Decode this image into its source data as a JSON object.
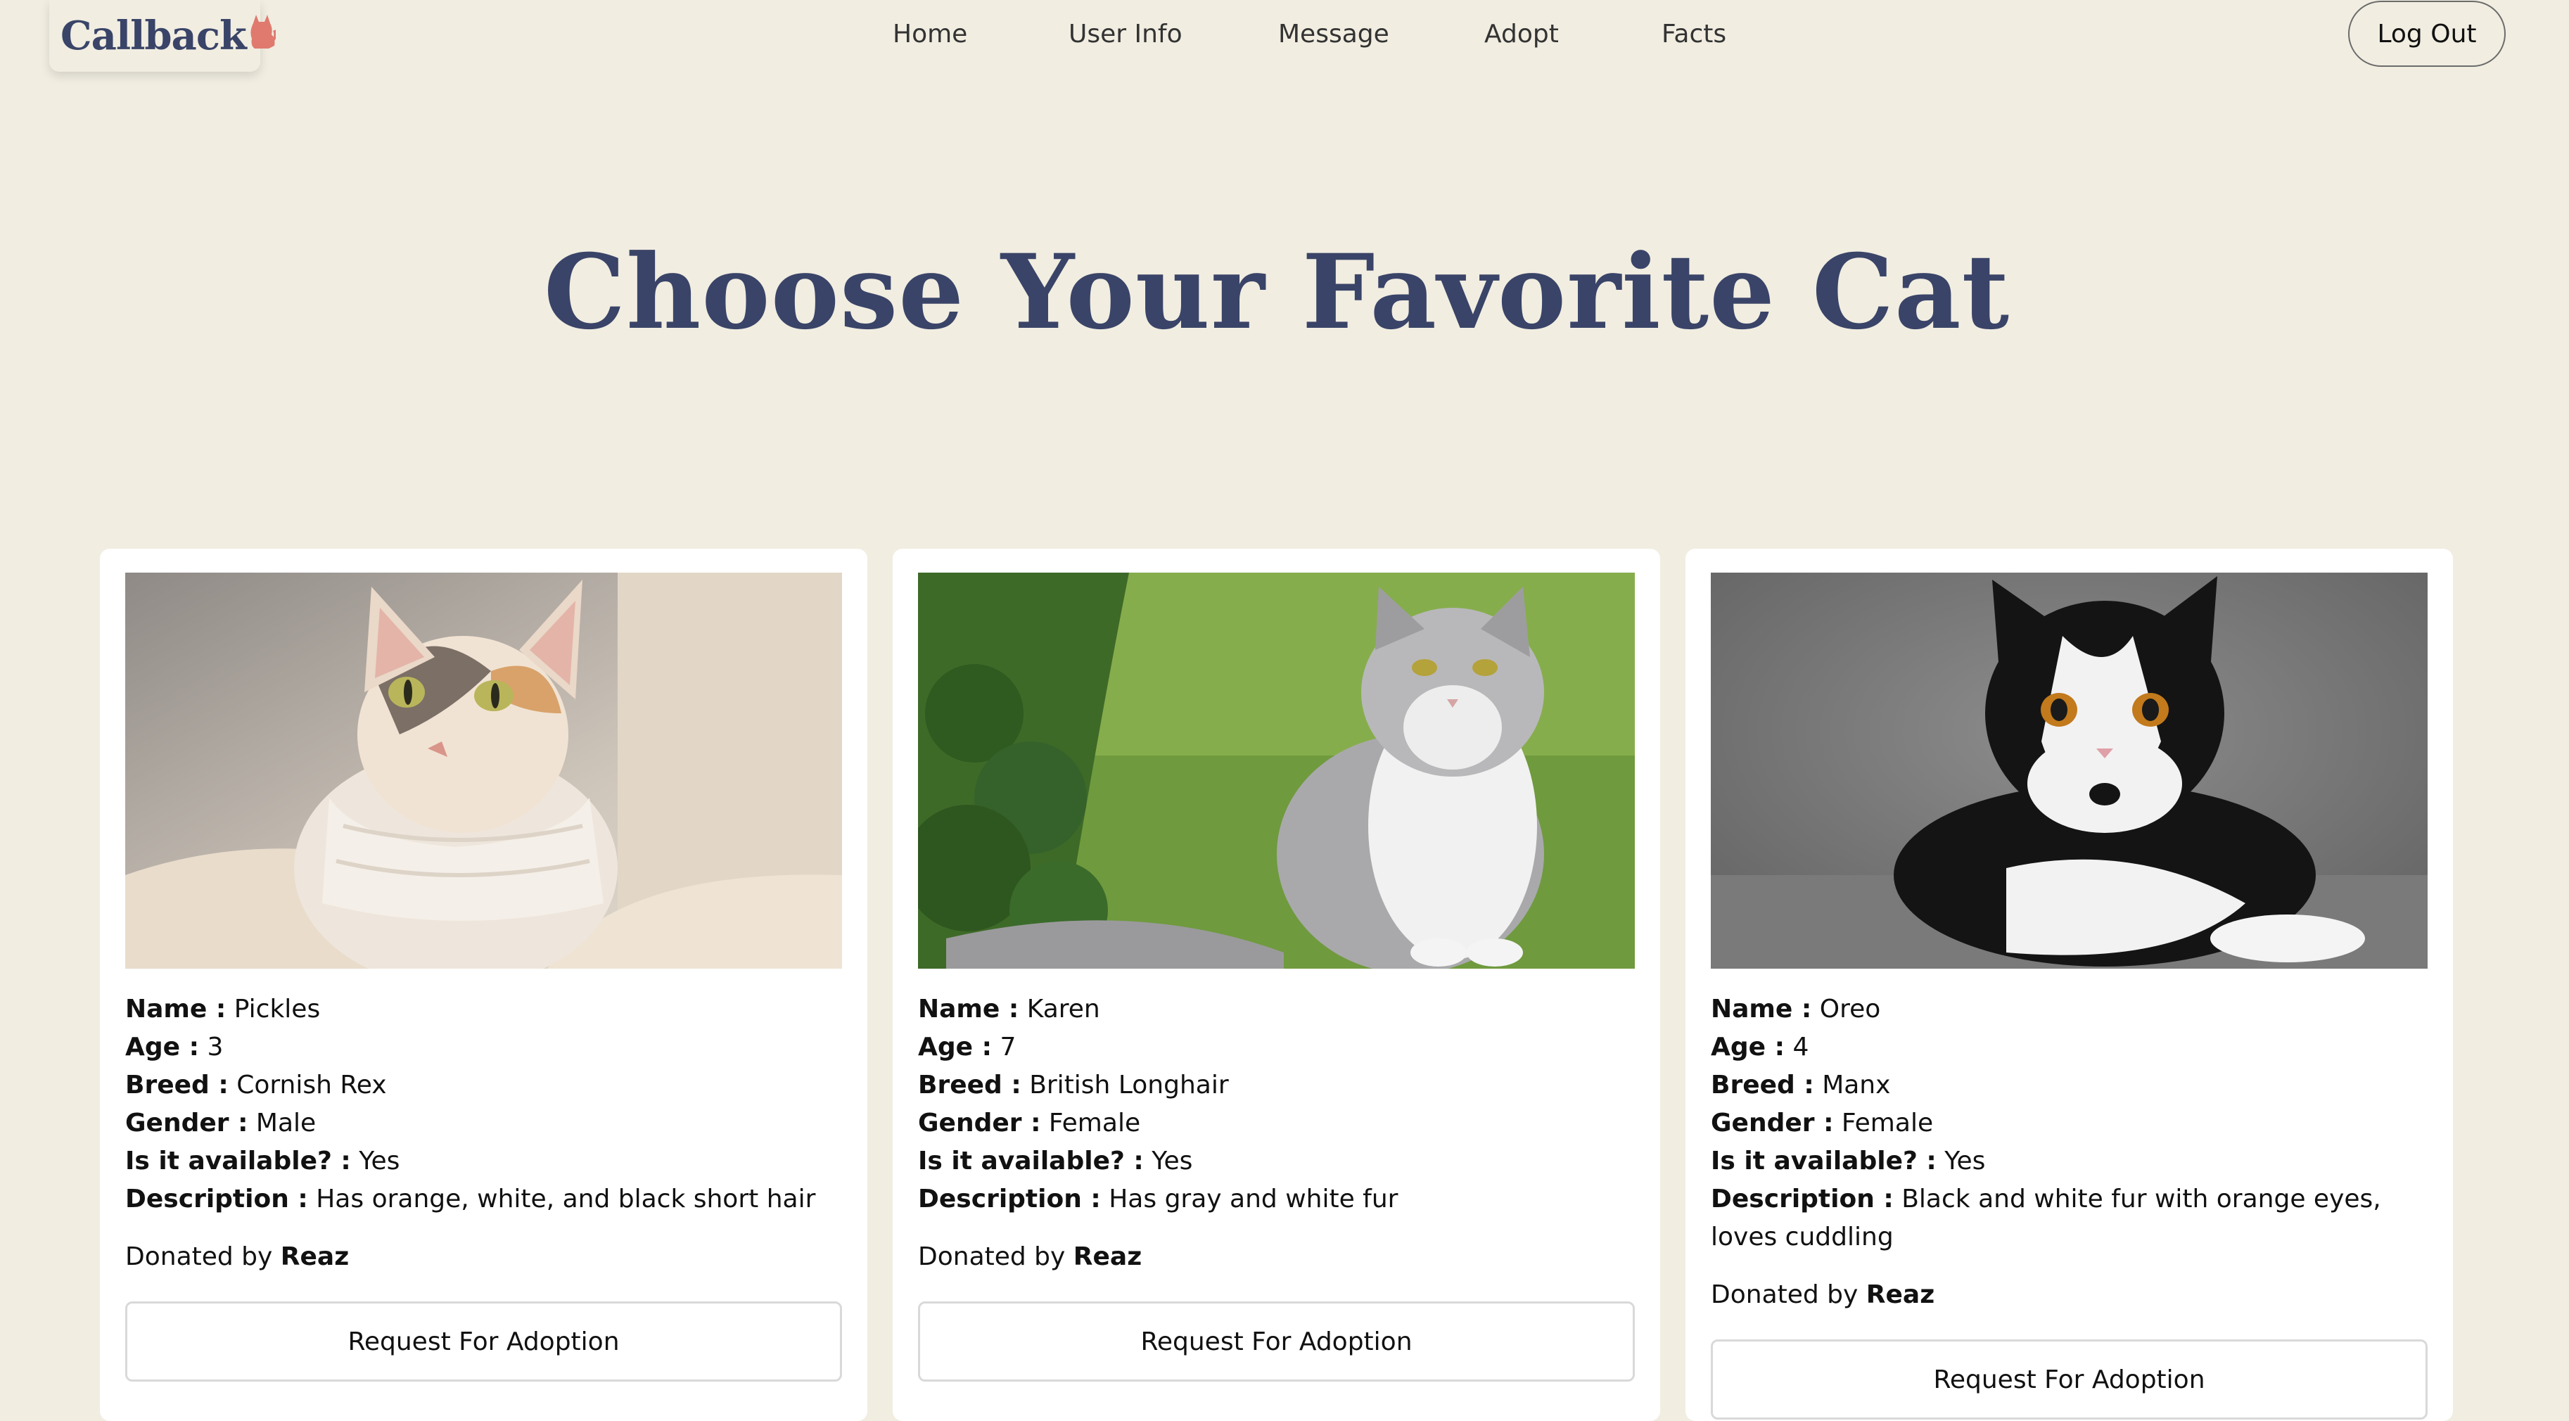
{
  "brand": {
    "name": "Callback",
    "accent": "#e07a6e",
    "title_color": "#3a4468"
  },
  "nav": {
    "items": [
      "Home",
      "User Info",
      "Message",
      "Adopt",
      "Facts"
    ],
    "logout_label": "Log Out"
  },
  "hero": {
    "title": "Choose Your Favorite Cat"
  },
  "labels": {
    "name": "Name :",
    "age": "Age :",
    "breed": "Breed :",
    "gender": "Gender :",
    "available": "Is it available? :",
    "description": "Description :",
    "donated_by": "Donated by",
    "request_button": "Request For Adoption"
  },
  "cats": [
    {
      "name": "Pickles",
      "age": "3",
      "breed": "Cornish Rex",
      "gender": "Male",
      "available": "Yes",
      "description": "Has orange, white, and black short hair",
      "donor": "Reaz"
    },
    {
      "name": "Karen",
      "age": "7",
      "breed": "British Longhair",
      "gender": "Female",
      "available": "Yes",
      "description": "Has gray and white fur",
      "donor": "Reaz"
    },
    {
      "name": "Oreo",
      "age": "4",
      "breed": "Manx",
      "gender": "Female",
      "available": "Yes",
      "description": "Black and white fur with orange eyes, loves cuddling",
      "donor": "Reaz"
    }
  ]
}
